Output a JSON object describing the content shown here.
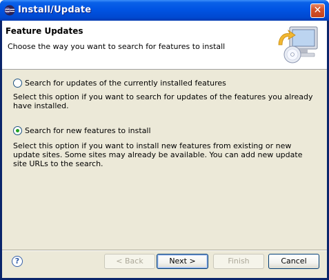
{
  "window": {
    "title": "Install/Update"
  },
  "header": {
    "title": "Feature Updates",
    "description": "Choose the way you want to search for features to install"
  },
  "options": [
    {
      "label": "Search for updates of the currently installed features",
      "description": "Select this option if you want to search for updates of the features you already have installed.",
      "checked": false
    },
    {
      "label": "Search for new features to install",
      "description": "Select this option if you want to install new features from existing or new update sites. Some sites may already be available. You can add new update site URLs to the search.",
      "checked": true
    }
  ],
  "buttons": {
    "back": "< Back",
    "next": "Next >",
    "finish": "Finish",
    "cancel": "Cancel",
    "help": "?"
  },
  "icons": {
    "app": "eclipse-icon",
    "close": "close-icon",
    "wizard": "install-update-wizard-icon",
    "help": "help-icon"
  },
  "colors": {
    "titlebar": "#0054e3",
    "dialog_bg": "#ece9d8",
    "radio_check": "#21a121"
  }
}
